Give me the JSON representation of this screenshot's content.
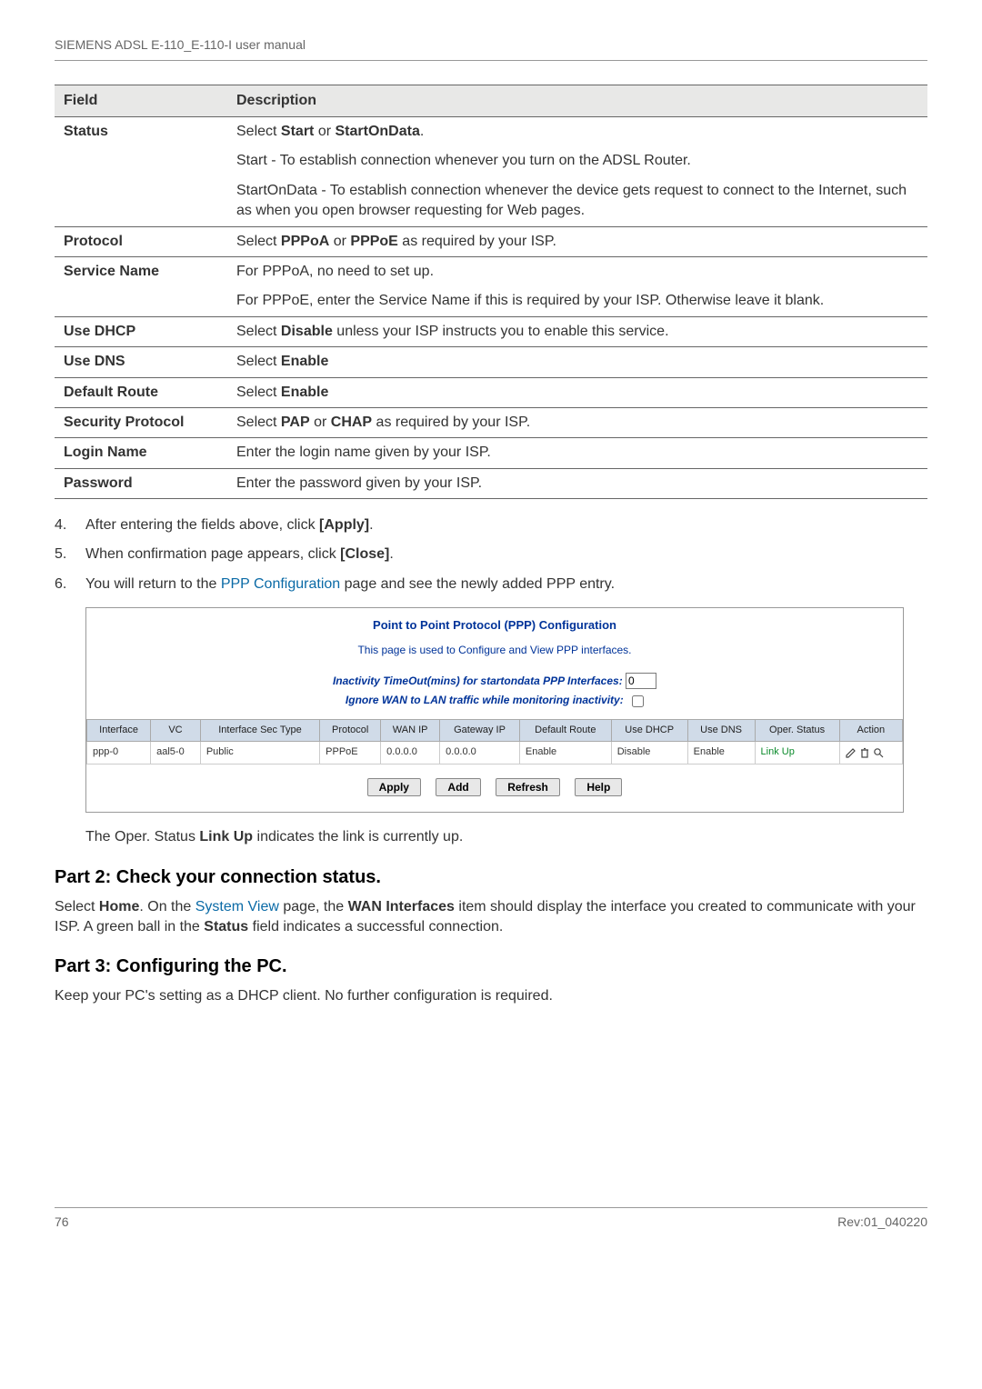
{
  "header": {
    "title": "SIEMENS ADSL E-110_E-110-I user manual"
  },
  "fields_table": {
    "head": {
      "field": "Field",
      "desc": "Description"
    },
    "rows": [
      {
        "label": "Status",
        "cells": [
          {
            "prefix": "Select ",
            "bold1": "Start",
            "mid": " or ",
            "bold2": "StartOnData",
            "suffix": ".",
            "row_top": true
          },
          {
            "text": "Start - To establish connection whenever you turn on the ADSL Router."
          },
          {
            "text": "StartOnData - To establish connection whenever the device gets request to connect to the Internet, such as when you open browser requesting for Web pages."
          }
        ]
      },
      {
        "label": "Protocol",
        "cells": [
          {
            "prefix": "Select ",
            "bold1": "PPPoA",
            "mid": " or ",
            "bold2": "PPPoE",
            "suffix": " as required by your ISP.",
            "row_top": true
          }
        ]
      },
      {
        "label": "Service Name",
        "cells": [
          {
            "text": "For PPPoA, no need to set up.",
            "row_top": true
          },
          {
            "text": "For PPPoE, enter the Service Name if this is required by your ISP. Otherwise leave it blank."
          }
        ]
      },
      {
        "label": "Use DHCP",
        "cells": [
          {
            "prefix": "Select ",
            "bold1": "Disable",
            "suffix": " unless your ISP instructs you to enable this service.",
            "row_top": true
          }
        ]
      },
      {
        "label": "Use DNS",
        "cells": [
          {
            "prefix": "Select ",
            "bold1": "Enable",
            "row_top": true
          }
        ]
      },
      {
        "label": "Default Route",
        "cells": [
          {
            "prefix": "Select ",
            "bold1": "Enable",
            "row_top": true
          }
        ]
      },
      {
        "label": "Security Protocol",
        "cells": [
          {
            "prefix": "Select ",
            "bold1": "PAP",
            "mid": " or ",
            "bold2": "CHAP",
            "suffix": " as required by your ISP.",
            "row_top": true
          }
        ]
      },
      {
        "label": "Login Name",
        "cells": [
          {
            "text": "Enter the login name given by your ISP.",
            "row_top": true
          }
        ]
      },
      {
        "label": "Password",
        "cells": [
          {
            "text": "Enter the password given by your ISP.",
            "row_top": true
          }
        ]
      }
    ]
  },
  "steps": {
    "s4": {
      "pre": "After entering the fields above, click ",
      "bold": "[Apply]",
      "post": "."
    },
    "s5": {
      "pre": "When confirmation page appears, click ",
      "bold": "[Close]",
      "post": "."
    },
    "s6": {
      "pre": "You will return to the ",
      "link": "PPP Configuration",
      "post": " page and see the newly added PPP entry."
    }
  },
  "config": {
    "title": "Point to Point Protocol (PPP) Configuration",
    "subtitle": "This page is used to Configure and View PPP interfaces.",
    "inactivity_label": "Inactivity TimeOut(mins) for startondata PPP Interfaces:",
    "inactivity_value": "0",
    "ignore_label": "Ignore WAN to LAN traffic while monitoring inactivity:",
    "columns": [
      "Interface",
      "VC",
      "Interface Sec Type",
      "Protocol",
      "WAN IP",
      "Gateway IP",
      "Default Route",
      "Use DHCP",
      "Use DNS",
      "Oper. Status",
      "Action"
    ],
    "row": {
      "interface": "ppp-0",
      "vc": "aal5-0",
      "sectype": "Public",
      "protocol": "PPPoE",
      "wanip": "0.0.0.0",
      "gwip": "0.0.0.0",
      "defroute": "Enable",
      "usedhcp": "Disable",
      "usedns": "Enable",
      "oper": "Link Up"
    },
    "buttons": {
      "apply": "Apply",
      "add": "Add",
      "refresh": "Refresh",
      "help": "Help"
    }
  },
  "after_panel": {
    "pre": "The Oper. Status ",
    "bold": "Link Up",
    "post": " indicates the link is currently up."
  },
  "part2": {
    "heading": "Part 2: Check your connection status.",
    "p_pre": "Select ",
    "p_b1": "Home",
    "p_mid1": ". On the ",
    "p_link": "System View",
    "p_mid2": " page, the ",
    "p_b2": "WAN Interfaces",
    "p_mid3": " item should display the interface you created to communicate with your ISP. A green ball in the ",
    "p_b3": "Status",
    "p_post": " field indicates a successful connection."
  },
  "part3": {
    "heading": "Part 3: Configuring the PC.",
    "p": "Keep your PC's setting as a DHCP client. No further configuration is required."
  },
  "footer": {
    "page": "76",
    "rev": "Rev:01_040220"
  }
}
